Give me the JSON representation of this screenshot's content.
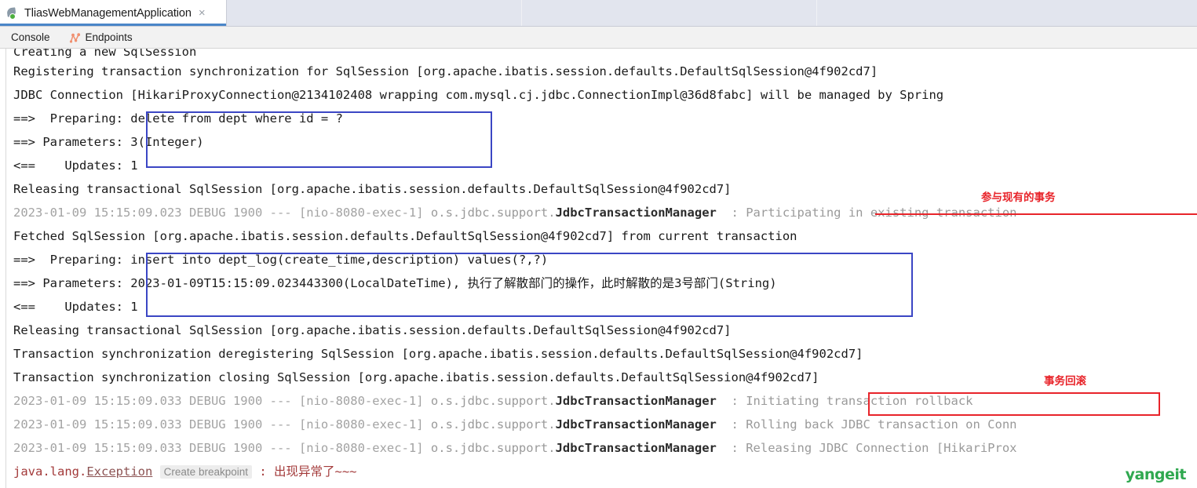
{
  "window": {
    "tab": {
      "title": "TliasWebManagementApplication",
      "close_label": "×",
      "icon": "spring-boot-run-icon"
    }
  },
  "toolbar": {
    "tabs": [
      {
        "label": "Console",
        "icon": "console-icon",
        "active": true
      },
      {
        "label": "Endpoints",
        "icon": "endpoints-graph-icon",
        "active": false
      }
    ]
  },
  "console": {
    "lines": [
      {
        "id": "line-0",
        "clipped": true,
        "segments": [
          {
            "text": "Creating a new SqlSession",
            "style": "plain"
          }
        ]
      },
      {
        "id": "line-1",
        "segments": [
          {
            "text": "Registering transaction synchronization for SqlSession [org.apache.ibatis.session.defaults.DefaultSqlSession@4f902cd7]",
            "style": "plain"
          }
        ]
      },
      {
        "id": "line-2",
        "segments": [
          {
            "text": "JDBC Connection [HikariProxyConnection@2134102408 wrapping com.mysql.cj.jdbc.ConnectionImpl@36d8fabc] will be managed by Spring",
            "style": "plain"
          }
        ]
      },
      {
        "id": "line-3",
        "segments": [
          {
            "text": "==>  Preparing: delete from dept where id = ?",
            "style": "plain"
          }
        ]
      },
      {
        "id": "line-4",
        "segments": [
          {
            "text": "==> Parameters: 3(Integer)",
            "style": "plain"
          }
        ]
      },
      {
        "id": "line-5",
        "segments": [
          {
            "text": "<==    Updates: 1",
            "style": "plain"
          }
        ]
      },
      {
        "id": "line-6",
        "segments": [
          {
            "text": "Releasing transactional SqlSession [org.apache.ibatis.session.defaults.DefaultSqlSession@4f902cd7]",
            "style": "plain"
          }
        ]
      },
      {
        "id": "line-7",
        "segments": [
          {
            "text": "2023-01-09 15:15:09.023 DEBUG 1900 --- [nio-8080-exec-1] ",
            "style": "ts"
          },
          {
            "text": "o.s.jdbc.support.",
            "style": "pkg"
          },
          {
            "text": "JdbcTransactionManager",
            "style": "cls"
          },
          {
            "text": "  : Participating in existing transaction",
            "style": "msg"
          }
        ]
      },
      {
        "id": "line-8",
        "segments": [
          {
            "text": "Fetched SqlSession [org.apache.ibatis.session.defaults.DefaultSqlSession@4f902cd7] from current transaction",
            "style": "plain"
          }
        ]
      },
      {
        "id": "line-9",
        "segments": [
          {
            "text": "==>  Preparing: insert into dept_log(create_time,description) values(?,?)",
            "style": "plain"
          }
        ]
      },
      {
        "id": "line-10",
        "segments": [
          {
            "text": "==> Parameters: 2023-01-09T15:15:09.023443300(LocalDateTime), 执行了解散部门的操作，此时解散的是3号部门(String)",
            "style": "plain"
          }
        ]
      },
      {
        "id": "line-11",
        "segments": [
          {
            "text": "<==    Updates: 1",
            "style": "plain"
          }
        ]
      },
      {
        "id": "line-12",
        "segments": [
          {
            "text": "Releasing transactional SqlSession [org.apache.ibatis.session.defaults.DefaultSqlSession@4f902cd7]",
            "style": "plain"
          }
        ]
      },
      {
        "id": "line-13",
        "segments": [
          {
            "text": "Transaction synchronization deregistering SqlSession [org.apache.ibatis.session.defaults.DefaultSqlSession@4f902cd7]",
            "style": "plain"
          }
        ]
      },
      {
        "id": "line-14",
        "segments": [
          {
            "text": "Transaction synchronization closing SqlSession [org.apache.ibatis.session.defaults.DefaultSqlSession@4f902cd7]",
            "style": "plain"
          }
        ]
      },
      {
        "id": "line-15",
        "segments": [
          {
            "text": "2023-01-09 15:15:09.033 DEBUG 1900 --- [nio-8080-exec-1] ",
            "style": "ts"
          },
          {
            "text": "o.s.jdbc.support.",
            "style": "pkg"
          },
          {
            "text": "JdbcTransactionManager",
            "style": "cls"
          },
          {
            "text": "  : Initiating transaction rollback",
            "style": "msg"
          }
        ]
      },
      {
        "id": "line-16",
        "segments": [
          {
            "text": "2023-01-09 15:15:09.033 DEBUG 1900 --- [nio-8080-exec-1] ",
            "style": "ts"
          },
          {
            "text": "o.s.jdbc.support.",
            "style": "pkg"
          },
          {
            "text": "JdbcTransactionManager",
            "style": "cls"
          },
          {
            "text": "  : Rolling back JDBC transaction on Conn",
            "style": "msg"
          }
        ]
      },
      {
        "id": "line-17",
        "segments": [
          {
            "text": "2023-01-09 15:15:09.033 DEBUG 1900 --- [nio-8080-exec-1] ",
            "style": "ts"
          },
          {
            "text": "o.s.jdbc.support.",
            "style": "pkg"
          },
          {
            "text": "JdbcTransactionManager",
            "style": "cls"
          },
          {
            "text": "  : Releasing JDBC Connection [HikariProx",
            "style": "msg"
          }
        ]
      },
      {
        "id": "line-18",
        "exception": true,
        "segments": [
          {
            "text": "java.lang.",
            "style": "err"
          },
          {
            "text": "Exception",
            "style": "errlink"
          },
          {
            "text": "Create breakpoint",
            "style": "chip"
          },
          {
            "text": ": 出现异常了~~~",
            "style": "err"
          }
        ]
      }
    ]
  },
  "annotations": [
    {
      "id": "anno-participating",
      "text": "参与现有的事务",
      "color": "#e8242a",
      "kind": "underline"
    },
    {
      "id": "anno-rollback",
      "text": "事务回滚",
      "color": "#e8242a",
      "kind": "box"
    }
  ],
  "watermark": {
    "text": "yangeit",
    "color": "#2fa84f"
  },
  "theme": {
    "highlight_box_blue": "#3b46c4",
    "highlight_box_red": "#e8242a",
    "tab_underline": "#4a86c8",
    "endpoints_icon": "#f09070"
  }
}
